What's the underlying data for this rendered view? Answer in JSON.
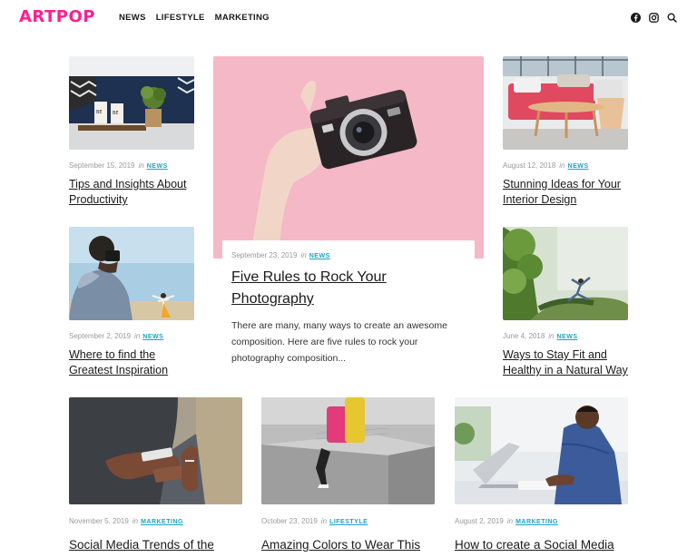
{
  "header": {
    "logo": "ARTPOP",
    "nav": [
      "NEWS",
      "LIFESTYLE",
      "MARKETING"
    ],
    "icons": [
      "facebook-icon",
      "instagram-icon",
      "search-icon"
    ]
  },
  "colors": {
    "brand": "#ff1f8e",
    "category": "#1aa4c8",
    "meta": "#9a9a9a"
  },
  "posts": [
    {
      "date": "September 15, 2019",
      "in": "in",
      "category": "NEWS",
      "title": "Tips and Insights About Productivity"
    },
    {
      "date": "August 12, 2018",
      "in": "in",
      "category": "NEWS",
      "title": "Stunning Ideas for Your Interior Design"
    },
    {
      "date": "September 2, 2019",
      "in": "in",
      "category": "NEWS",
      "title": "Where to find the Greatest Inspiration"
    },
    {
      "date": "June 4, 2018",
      "in": "in",
      "category": "NEWS",
      "title": "Ways to Stay Fit and Healthy in a Natural Way"
    },
    {
      "date": "November 5, 2019",
      "in": "in",
      "category": "MARKETING",
      "title": "Social Media Trends of the"
    },
    {
      "date": "October 23, 2019",
      "in": "in",
      "category": "LIFESTYLE",
      "title": "Amazing Colors to Wear This"
    },
    {
      "date": "August 2, 2019",
      "in": "in",
      "category": "MARKETING",
      "title": "How to create a Social Media"
    }
  ],
  "featured": {
    "date": "September 23, 2019",
    "in": "in",
    "category": "NEWS",
    "title": "Five Rules to Rock Your Photography",
    "excerpt": "There are many, many ways to create an awesome composition. Here are five rules to rock your photography composition..."
  }
}
